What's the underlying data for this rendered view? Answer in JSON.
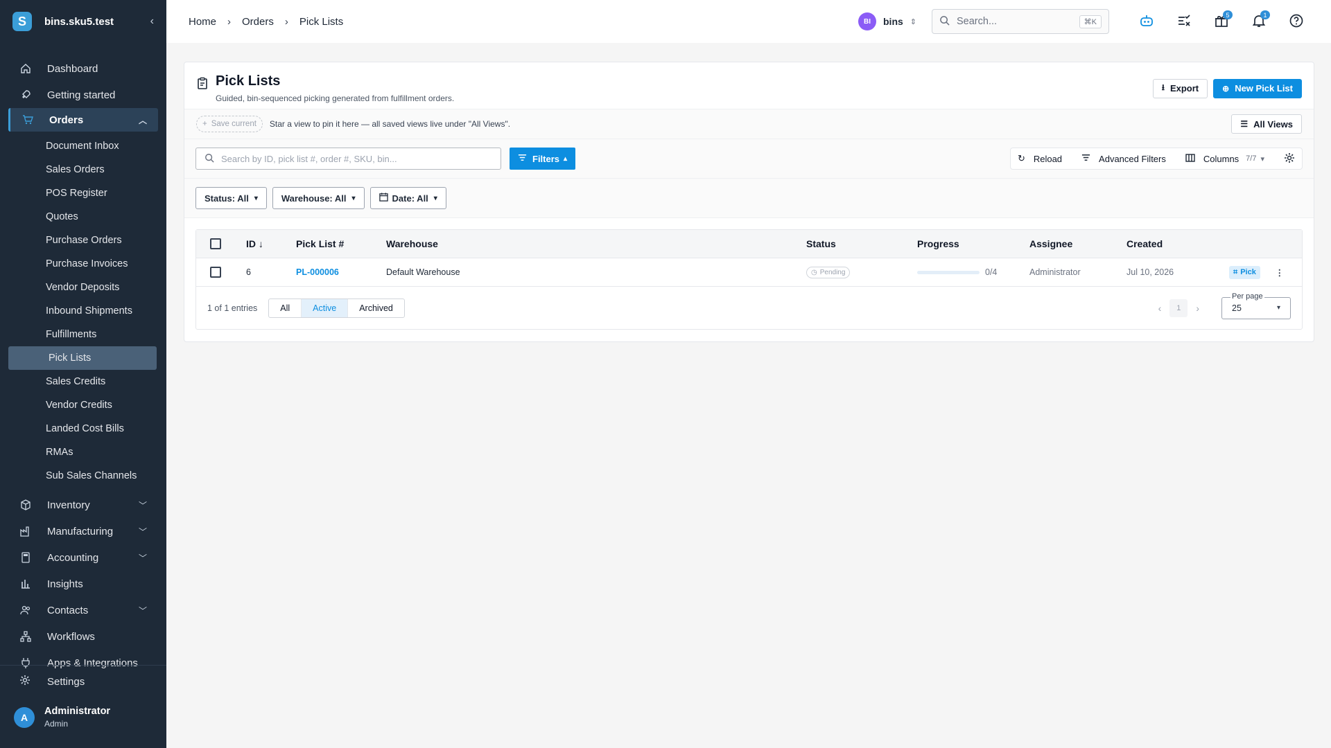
{
  "brand": {
    "name": "bins.sku5.test",
    "logo_letter": "S"
  },
  "sidebar": {
    "items": [
      {
        "label": "Dashboard",
        "icon": "home-icon"
      },
      {
        "label": "Getting started",
        "icon": "rocket-icon"
      }
    ],
    "orders": {
      "label": "Orders",
      "sub": [
        "Document Inbox",
        "Sales Orders",
        "POS Register",
        "Quotes",
        "Purchase Orders",
        "Purchase Invoices",
        "Vendor Deposits",
        "Inbound Shipments",
        "Fulfillments",
        "Pick Lists",
        "Sales Credits",
        "Vendor Credits",
        "Landed Cost Bills",
        "RMAs",
        "Sub Sales Channels"
      ]
    },
    "lower": [
      {
        "label": "Inventory",
        "expandable": true
      },
      {
        "label": "Manufacturing",
        "expandable": true
      },
      {
        "label": "Accounting",
        "expandable": true
      },
      {
        "label": "Insights",
        "expandable": false
      },
      {
        "label": "Contacts",
        "expandable": true
      },
      {
        "label": "Workflows",
        "expandable": false
      },
      {
        "label": "Apps & Integrations",
        "expandable": false
      }
    ],
    "settings": "Settings",
    "user": {
      "initial": "A",
      "name": "Administrator",
      "role": "Admin"
    }
  },
  "breadcrumb": {
    "home": "Home",
    "orders": "Orders",
    "current": "Pick Lists",
    "sep": "›"
  },
  "topbar": {
    "tenant_initials": "BI",
    "tenant_name": "bins",
    "search_placeholder": "Search...",
    "search_shortcut": "⌘K",
    "gifts_badge": "5",
    "notifications_badge": "1"
  },
  "page": {
    "title": "Pick Lists",
    "subtitle": "Guided, bin-sequenced picking generated from fulfillment orders.",
    "export_label": "Export",
    "new_label": "New Pick List"
  },
  "views": {
    "save_current": "Save current",
    "hint": "Star a view to pin it here — all saved views live under \"All Views\".",
    "all_views": "All Views"
  },
  "toolbar": {
    "search_placeholder": "Search by ID, pick list #, order #, SKU, bin...",
    "filters": "Filters",
    "reload": "Reload",
    "advanced_filters": "Advanced Filters",
    "columns": "Columns",
    "columns_count": "7/7"
  },
  "chips": {
    "status": "Status: All",
    "warehouse": "Warehouse: All",
    "date": "Date: All"
  },
  "table": {
    "headers": {
      "id": "ID",
      "pick_list": "Pick List #",
      "warehouse": "Warehouse",
      "status": "Status",
      "progress": "Progress",
      "assignee": "Assignee",
      "created": "Created"
    },
    "rows": [
      {
        "id": "6",
        "pick_list": "PL-000006",
        "warehouse": "Default Warehouse",
        "status": "Pending",
        "progress_text": "0/4",
        "progress_fraction": 0,
        "assignee": "Administrator",
        "created": "Jul 10, 2026",
        "action": "Pick"
      }
    ],
    "footer": {
      "entries": "1 of 1 entries",
      "segments": [
        "All",
        "Active",
        "Archived"
      ],
      "active_segment": "Active",
      "page": "1",
      "per_page_label": "Per page",
      "per_page": "25"
    }
  },
  "colors": {
    "sidebar_bg": "#1e2a38",
    "accent": "#0d8ee0",
    "tenant_avatar": "#8b5cf6"
  }
}
